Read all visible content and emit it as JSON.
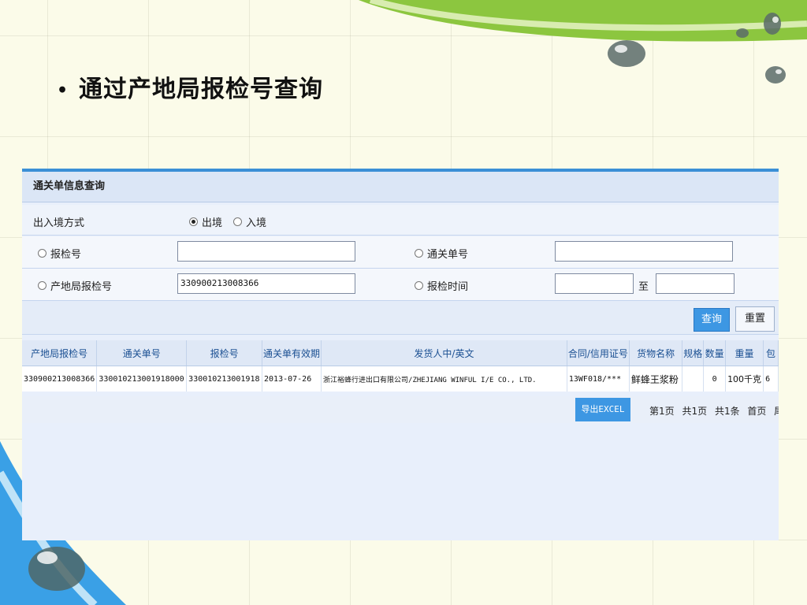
{
  "slide": {
    "bullet": "•",
    "title": "通过产地局报检号查询"
  },
  "panel": {
    "title": "通关单信息查询",
    "direction_label": "出入境方式",
    "direction_options": [
      "出境",
      "入境"
    ],
    "direction_selected": "出境",
    "fields": {
      "inspection_no_label": "报检号",
      "inspection_no_value": "",
      "customs_no_label": "通关单号",
      "customs_no_value": "",
      "origin_no_label": "产地局报检号",
      "origin_no_value": "330900213008366",
      "inspection_time_label": "报检时间",
      "time_from_value": "",
      "time_to_sep": "至",
      "time_to_value": ""
    },
    "buttons": {
      "query": "查询",
      "reset": "重置",
      "export": "导出EXCEL"
    },
    "table": {
      "headers": [
        "产地局报检号",
        "通关单号",
        "报检号",
        "通关单有效期",
        "发货人中/英文",
        "合同/信用证号",
        "货物名称",
        "规格",
        "数量",
        "重量",
        "包"
      ],
      "rows": [
        [
          "330900213008366",
          "330010213001918000",
          "330010213001918",
          "2013-07-26",
          "浙江裕蜂行进出口有限公司/ZHEJIANG WINFUL I/E CO., LTD.",
          "13WF018/***",
          "鲜蜂王浆粉",
          "",
          "0",
          "100千克",
          "6"
        ]
      ]
    },
    "pager": {
      "page": "第1页",
      "total_pages": "共1页",
      "total_records": "共1条",
      "first": "首页",
      "last": "尾页"
    }
  },
  "colors": {
    "accent_blue": "#3d97e3",
    "panel_bg": "#e8effb",
    "green": "#8cc63f"
  },
  "icons": [
    "water-drop-icon"
  ]
}
